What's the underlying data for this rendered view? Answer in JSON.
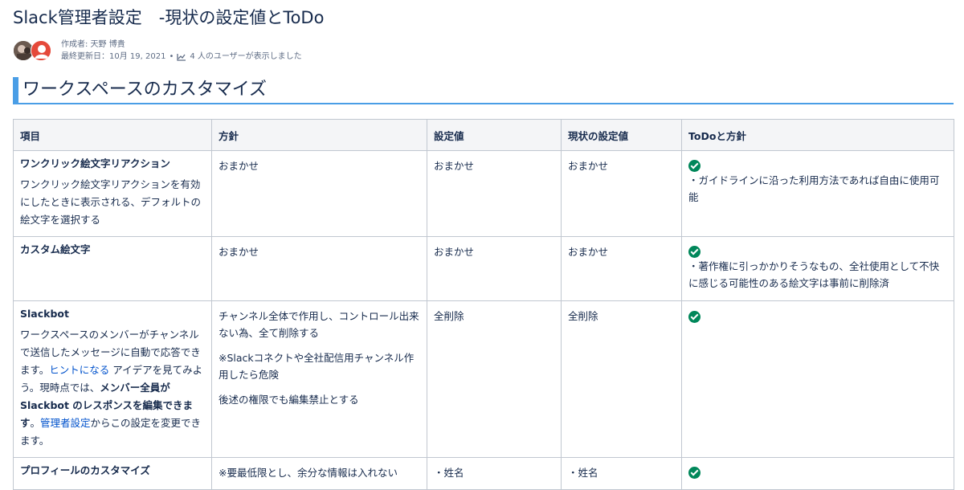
{
  "page": {
    "title": "Slack管理者設定　-現状の設定値とToDo"
  },
  "byline": {
    "author": "作成者: 天野 博貴",
    "updated": "最終更新日：10月 19, 2021",
    "views": "4 人のユーザーが表示しました"
  },
  "section": {
    "heading": "ワークスペースのカスタマイズ"
  },
  "table": {
    "headers": [
      "項目",
      "方針",
      "設定値",
      "現状の設定値",
      "ToDoと方針"
    ],
    "rows": [
      {
        "title": "ワンクリック絵文字リアクション",
        "desc": "ワンクリック絵文字リアクションを有効にしたときに表示される、デフォルトの絵文字を選択する",
        "policy": "おまかせ",
        "value": "おまかせ",
        "current": "おまかせ",
        "todo": "・ガイドラインに沿った利用方法であれば自由に使用可能"
      },
      {
        "title": "カスタム絵文字",
        "policy": "おまかせ",
        "value": "おまかせ",
        "current": "おまかせ",
        "todo": "・著作権に引っかかりそうなもの、全社使用として不快に感じる可能性のある絵文字は事前に削除済"
      },
      {
        "title": "Slackbot",
        "desc_parts": {
          "a": "ワークスペースのメンバーがチャンネルで送信したメッセージに自動で応答できます。",
          "link1": "ヒントになる",
          "b": " アイデアを見てみよう。現時点では、",
          "bold": "メンバー全員が Slackbot のレスポンスを編集できます",
          "c": "。",
          "link2": "管理者設定",
          "d": "からこの設定を変更できます。"
        },
        "policy_lines": [
          "チャンネル全体で作用し、コントロール出来ない為、全て削除する",
          "※Slackコネクトや全社配信用チャンネル作用したら危険",
          "後述の権限でも編集禁止とする"
        ],
        "value": "全削除",
        "current": "全削除"
      },
      {
        "title": "プロフィールのカスタマイズ",
        "policy": "※要最低限とし、余分な情報は入れない",
        "value": "・姓名",
        "current": "・姓名"
      }
    ]
  }
}
